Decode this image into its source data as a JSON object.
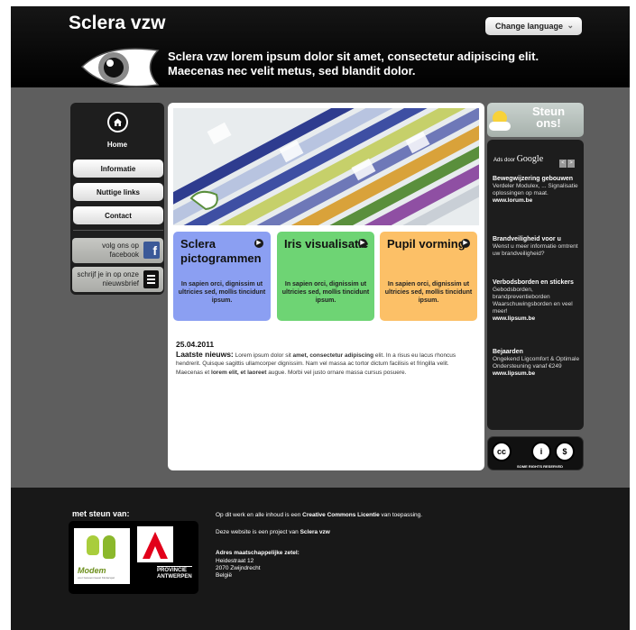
{
  "header": {
    "site_title": "Sclera vzw",
    "language_button": "Change language",
    "tagline": "Sclera vzw lorem ipsum dolor sit amet, consectetur adipiscing elit. Maecenas nec velit metus, sed blandit dolor."
  },
  "nav": {
    "home": "Home",
    "items": [
      "Informatie",
      "Nuttige links",
      "Contact"
    ],
    "facebook": "volg ons op facebook",
    "newsletter": "schrijf je in op onze nieuwsbrief"
  },
  "tiles": [
    {
      "title": "Sclera pictogrammen",
      "body": "In sapien orci, dignissim ut ultricies sed, mollis tincidunt ipsum.",
      "color": "#8b9ff2"
    },
    {
      "title": "Iris visualisatie",
      "body": "In sapien orci, dignissim ut ultricies sed, mollis tincidunt ipsum.",
      "color": "#6ed474"
    },
    {
      "title": "Pupil vorming",
      "body": "In sapien orci, dignissim ut ultricies sed, mollis tincidunt ipsum.",
      "color": "#fcc067"
    }
  ],
  "news": {
    "date": "25.04.2011",
    "lead": "Laatste nieuws:",
    "t1": " Lorem ipsum dolor sit ",
    "b1": "amet, consectetur adipiscing",
    "t2": " elit. In a risus eu lacus rhoncus hendrerit. Quisque sagittis ullamcorper dignissim. Nam vel massa ac tortor dictum facilisis et fringilla velit. Maecenas et ",
    "b2": "lorem elit, et laoreet",
    "t3": " augue. Morbi vel justo ornare massa cursus posuere."
  },
  "steun": "Steun ons!",
  "ads": {
    "header_prefix": "Ads door",
    "header_brand": "Google",
    "prev": "<",
    "next": ">",
    "items": [
      {
        "title": "Bewegwijzering gebouwen",
        "text": "Verdeler Modulex, ... Signalisatie oplossingen op maat.",
        "url": "www.lorum.be"
      },
      {
        "title": "Brandveiligheid voor u",
        "text": "Wenst u meer informatie omtrent uw brandveiligheid?",
        "url": ""
      },
      {
        "title": "Verbodsborden en stickers",
        "text": "Gebodsborden, brandpreventieborden Waarschuwingsborden en veel meer!",
        "url": "www.lipsum.be"
      },
      {
        "title": "Bejaarden",
        "text": "Ongekend Ligcomfort & Optimale Ondersteuning vanaf €249",
        "url": "www.lipsum.be"
      }
    ]
  },
  "license": {
    "cc": "cc",
    "by": "i",
    "nc": "$",
    "text": "SOME RIGHTS RESERVED"
  },
  "footer": {
    "met_steun": "met steun van:",
    "modem_name": "Modem",
    "modem_sub": "voor Gewoonmeest Kinderspel",
    "prov_line1": "PROVINCIE",
    "prov_line2": "ANTWERPEN",
    "license_prefix": "Op dit werk en alle inhoud is een ",
    "license_bold": "Creative Commons Licentie",
    "license_suffix": " van toepassing.",
    "project_prefix": "Deze website is een project van ",
    "project_bold": "Sclera vzw",
    "address_title": "Adres maatschappelijke zetel:",
    "address_lines": [
      "Heidestraat 12",
      "2070 Zwijndrecht",
      "België"
    ]
  }
}
